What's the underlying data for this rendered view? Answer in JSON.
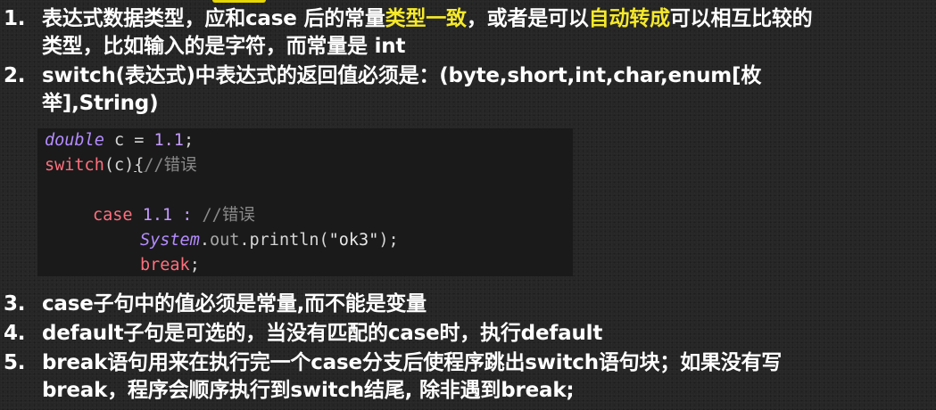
{
  "items": [
    {
      "number": "1.",
      "line1_part1": "表达式数据类型，应和case 后的常量",
      "line1_hl1": "类型一致",
      "line1_part2": "，或者是可以",
      "line1_hl2": "自动转成",
      "line1_part3": "可以相互比较的",
      "line2": "类型，比如输入的是字符，而常量是 int"
    },
    {
      "number": "2.",
      "line1": "switch(表达式)中表达式的返回值必须是：(byte,short,int,char,enum[枚",
      "line2": "举],String)"
    },
    {
      "number": "3.",
      "line1": "case子句中的值必须是常量,而不能是变量"
    },
    {
      "number": "4.",
      "line1": "default子句是可选的，当没有匹配的case时，执行default"
    },
    {
      "number": "5.",
      "line1": "break语句用来在执行完一个case分支后使程序跳出switch语句块；如果没有写",
      "line2": "break，程序会顺序执行到switch结尾, 除非遇到break;"
    }
  ],
  "code": {
    "l1_type": "double",
    "l1_rest": " c = ",
    "l1_num": "1.1",
    "l1_end": ";",
    "l2_kw": "switch",
    "l2_paren": "(c)",
    "l2_brace": "{",
    "l2_cmt": "//错误",
    "l3_kw": "case",
    "l3_num": "1.1",
    "l3_colon": " : ",
    "l3_cmt": "//错误",
    "l4_cls": "System",
    "l4_dot": ".",
    "l4_fld": "out",
    "l4_call": ".println(",
    "l4_str": "\"ok3\"",
    "l4_end": ");",
    "l5_kw": "break",
    "l5_end": ";"
  }
}
